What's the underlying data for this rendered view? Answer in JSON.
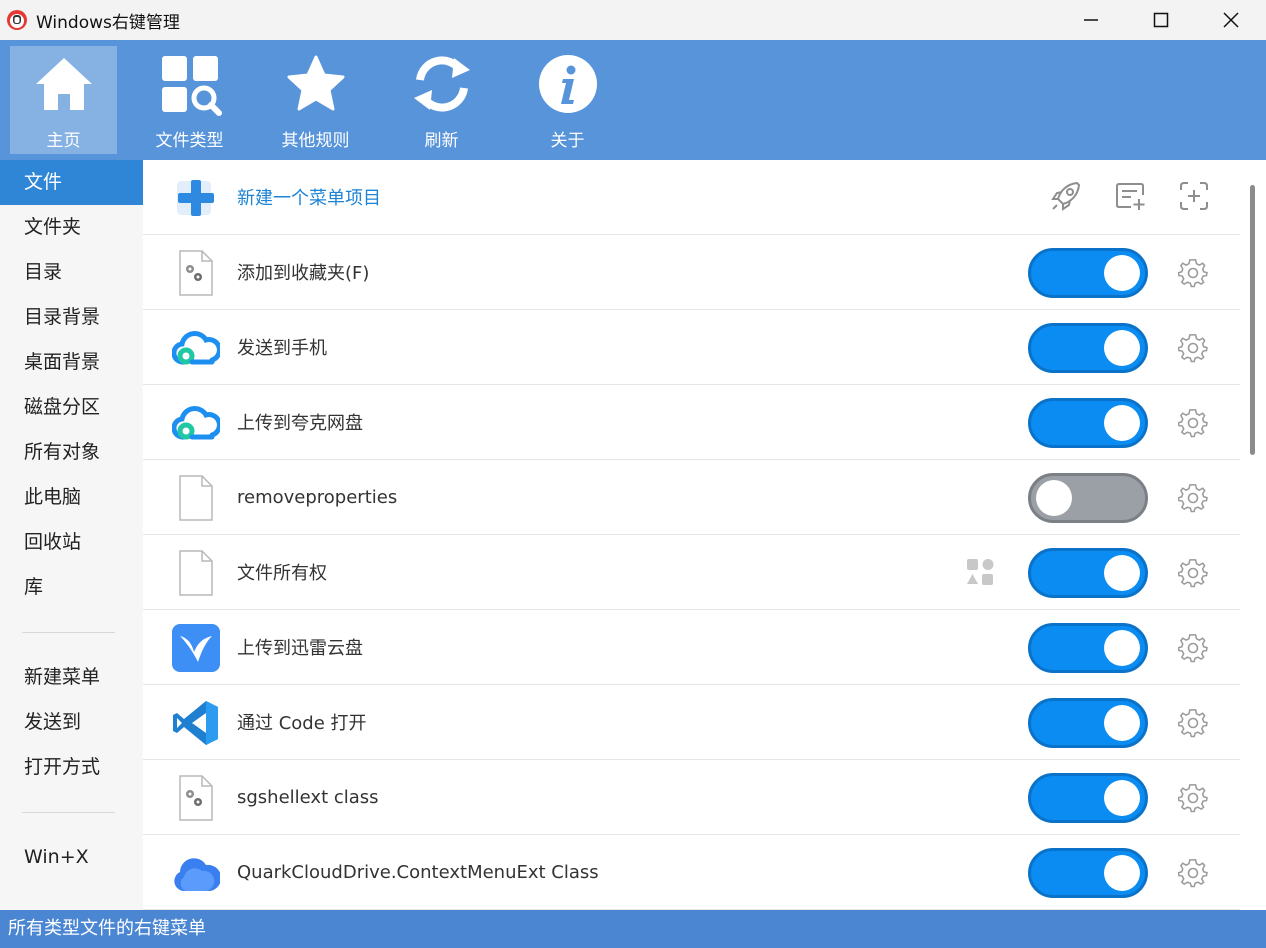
{
  "window": {
    "title": "Windows右键管理"
  },
  "toolbar": {
    "items": [
      {
        "label": "主页",
        "icon": "home-icon"
      },
      {
        "label": "文件类型",
        "icon": "grid-search-icon"
      },
      {
        "label": "其他规则",
        "icon": "star-icon"
      },
      {
        "label": "刷新",
        "icon": "refresh-icon"
      },
      {
        "label": "关于",
        "icon": "info-icon"
      }
    ]
  },
  "sidebar": {
    "items": [
      "文件",
      "文件夹",
      "目录",
      "目录背景",
      "桌面背景",
      "磁盘分区",
      "所有对象",
      "此电脑",
      "回收站",
      "库"
    ],
    "items2": [
      "新建菜单",
      "发送到",
      "打开方式"
    ],
    "items3": [
      "Win+X"
    ]
  },
  "list": {
    "new_item_label": "新建一个菜单项目",
    "rows": [
      {
        "label": "添加到收藏夹(F)",
        "icon": "settings-file-icon",
        "enabled": true
      },
      {
        "label": "发送到手机",
        "icon": "quark-cloud-icon",
        "enabled": true
      },
      {
        "label": "上传到夸克网盘",
        "icon": "quark-cloud-icon",
        "enabled": true
      },
      {
        "label": "removeproperties",
        "icon": "blank-file-icon",
        "enabled": false
      },
      {
        "label": "文件所有权",
        "icon": "blank-file-icon",
        "enabled": true
      },
      {
        "label": "上传到迅雷云盘",
        "icon": "xunlei-bird-icon",
        "enabled": true
      },
      {
        "label": "通过 Code 打开",
        "icon": "vscode-icon",
        "enabled": true
      },
      {
        "label": "sgshellext class",
        "icon": "settings-file-icon",
        "enabled": true
      },
      {
        "label": "QuarkCloudDrive.ContextMenuExt Class",
        "icon": "quark-drive-icon",
        "enabled": true
      }
    ]
  },
  "status": {
    "text": "所有类型文件的右键菜单"
  }
}
